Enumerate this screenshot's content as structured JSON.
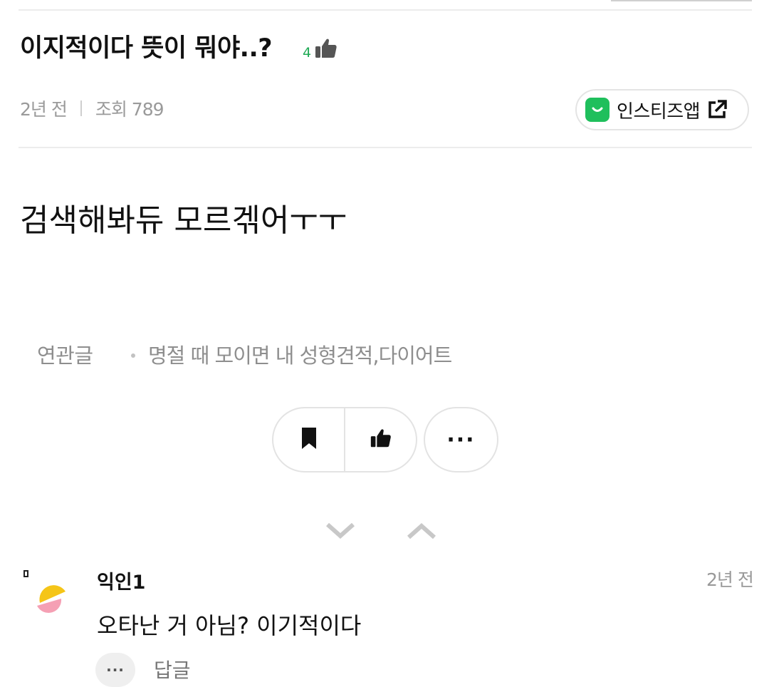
{
  "post": {
    "title": "이지적이다 뜻이 뭐야..?",
    "like_count": "4",
    "time_ago": "2년 전",
    "views": "조회 789",
    "body": "검색해봐듀 모르겎어ㅜㅜ"
  },
  "app_badge": {
    "label": "인스티즈앱",
    "brand_color": "#1fbf5c"
  },
  "related": {
    "label": "연관글",
    "items": [
      "명절 때 모이면 내 성형견적,다이어트"
    ]
  },
  "actions": {
    "bookmark_icon": "bookmark-icon",
    "like_icon": "thumbs-up-icon",
    "more_label": "···"
  },
  "nav": {
    "down_icon": "chevron-down-icon",
    "up_icon": "chevron-up-icon"
  },
  "comments": [
    {
      "author": "익인1",
      "time_ago": "2년 전",
      "text": "오타난 거 아님? 이기적이다",
      "more_label": "···",
      "reply_label": "답글"
    }
  ],
  "colors": {
    "accent_green": "#1faa55",
    "muted_text": "#9a9a9a",
    "avatar_yellow": "#f5c518",
    "avatar_pink": "#f5a0b4"
  }
}
